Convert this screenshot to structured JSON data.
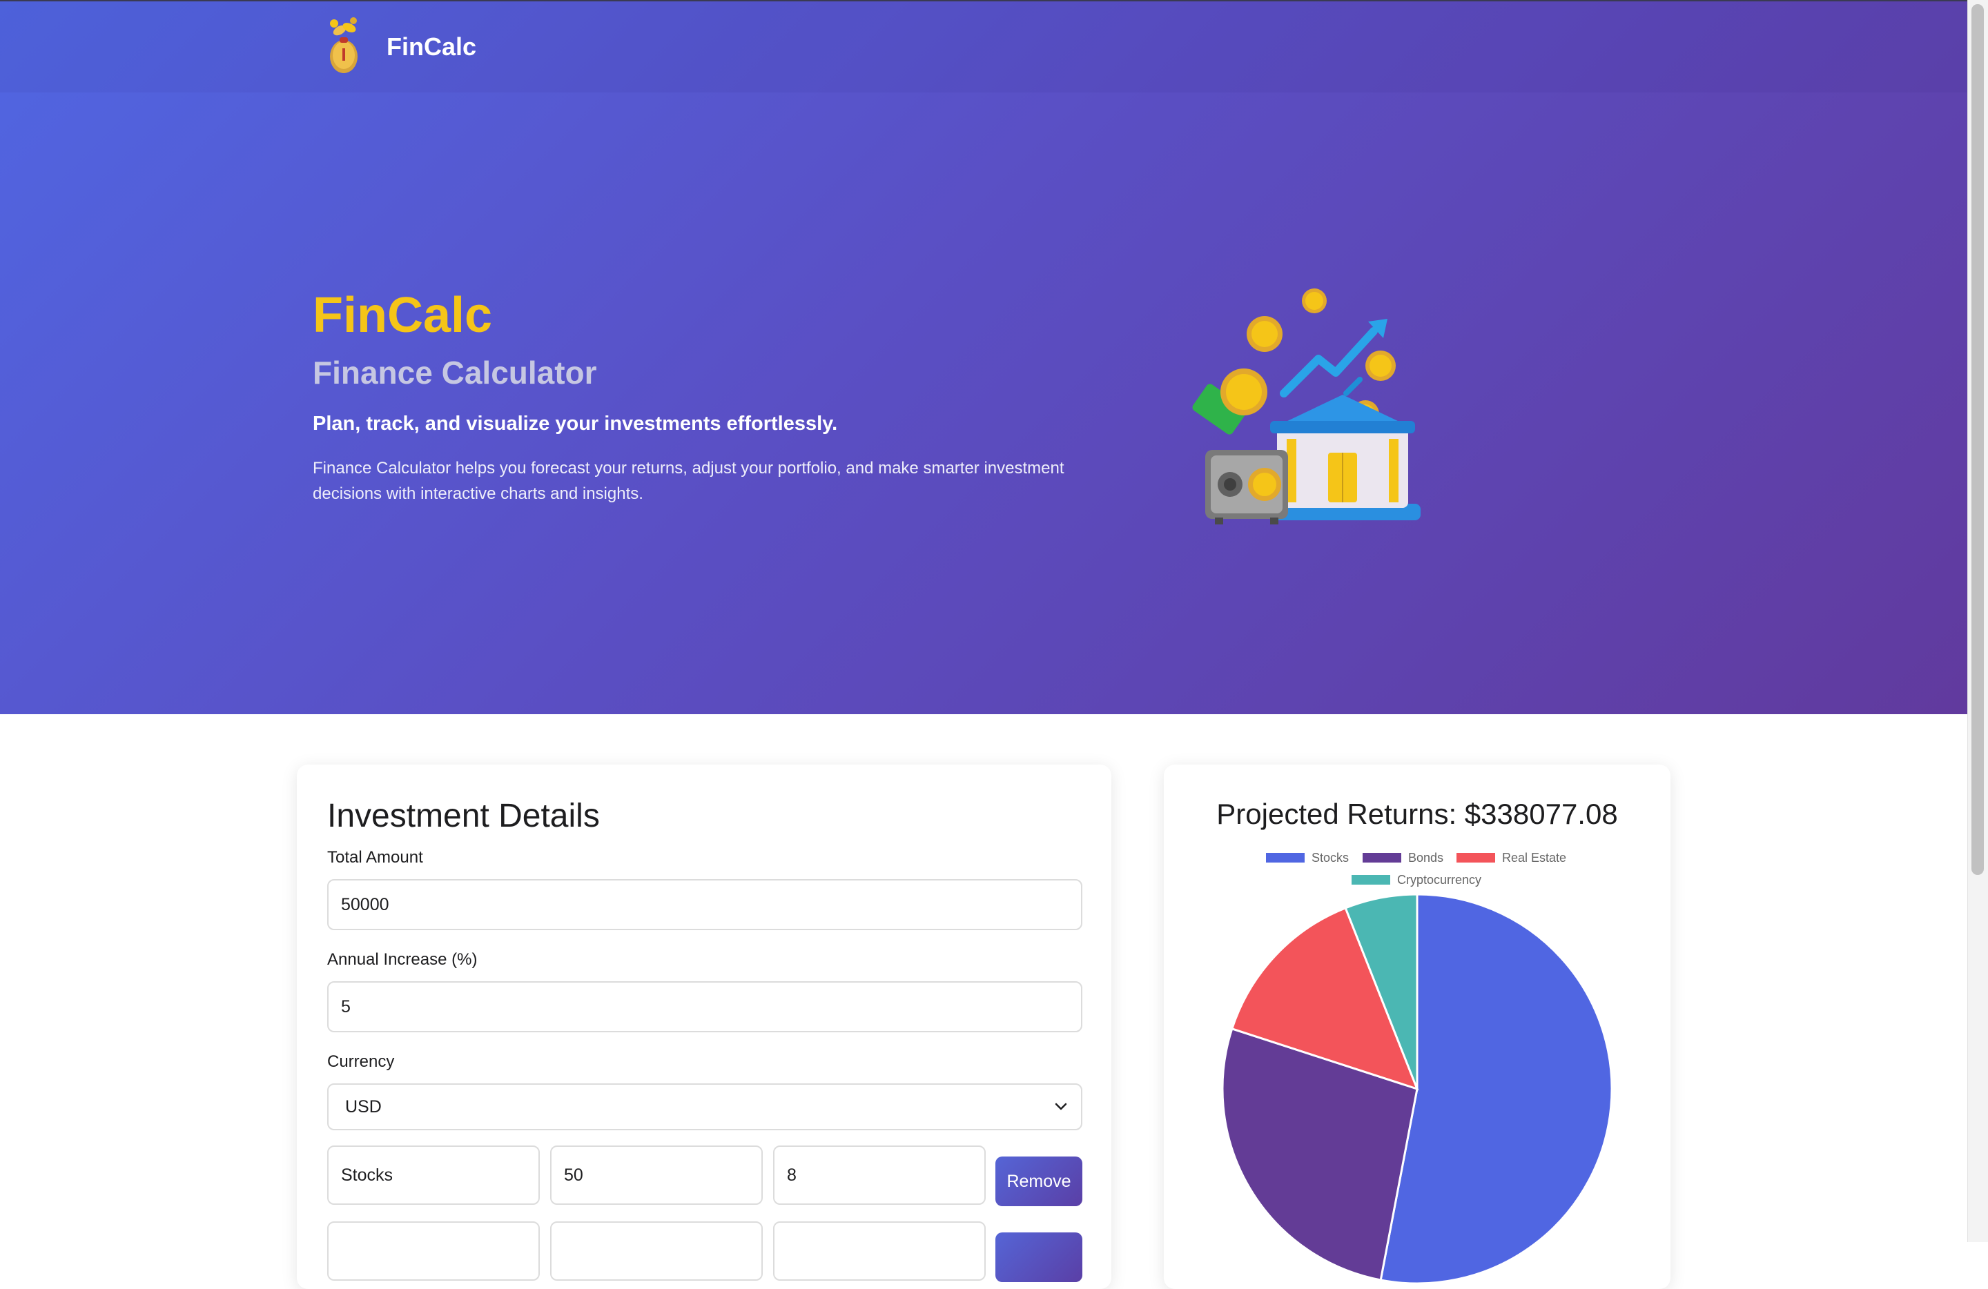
{
  "nav": {
    "brand": "FinCalc"
  },
  "hero": {
    "title": "FinCalc",
    "subtitle": "Finance Calculator",
    "tagline": "Plan, track, and visualize your investments effortlessly.",
    "description": "Finance Calculator helps you forecast your returns, adjust your portfolio, and make smarter investment decisions with interactive charts and insights."
  },
  "investment": {
    "title": "Investment Details",
    "total_amount_label": "Total Amount",
    "total_amount_value": "50000",
    "annual_increase_label": "Annual Increase (%)",
    "annual_increase_value": "5",
    "currency_label": "Currency",
    "currency_value": "USD",
    "rows": [
      {
        "name": "Stocks",
        "allocation": "50",
        "rate": "8",
        "remove_label": "Remove"
      },
      {
        "name": "",
        "allocation": "",
        "rate": "",
        "remove_label": ""
      }
    ]
  },
  "chart": {
    "title": "Projected Returns: $338077.08"
  },
  "chart_data": {
    "type": "pie",
    "title": "Projected Returns: $338077.08",
    "legend_position": "top",
    "labels": [
      "Stocks",
      "Bonds",
      "Real Estate",
      "Cryptocurrency"
    ],
    "values": [
      53,
      27,
      14,
      6
    ],
    "colors": [
      "#5066e2",
      "#633c96",
      "#f3545a",
      "#4bb7b3"
    ]
  },
  "colors": {
    "accent_yellow": "#f5c518",
    "button": "#5565d6",
    "hero_start": "#5066e2",
    "hero_end": "#613a9e"
  },
  "icons": {
    "nav_logo": "money-bag-icon",
    "hero_illustration": "bank-coins-illustration",
    "select_chevron": "chevron-down-icon"
  }
}
